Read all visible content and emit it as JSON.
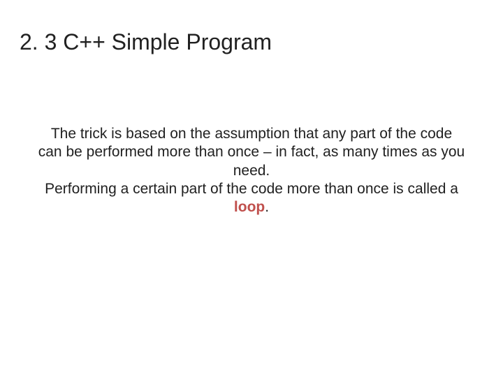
{
  "title": "2. 3 C++ Simple Program",
  "body": {
    "p1": "The trick is based on the assumption that any part of the code can be performed more than once – in fact, as many times as you need.",
    "p2_pre": "Performing a certain part of the code more than once is called a ",
    "p2_highlight": "loop",
    "p2_post": "."
  }
}
